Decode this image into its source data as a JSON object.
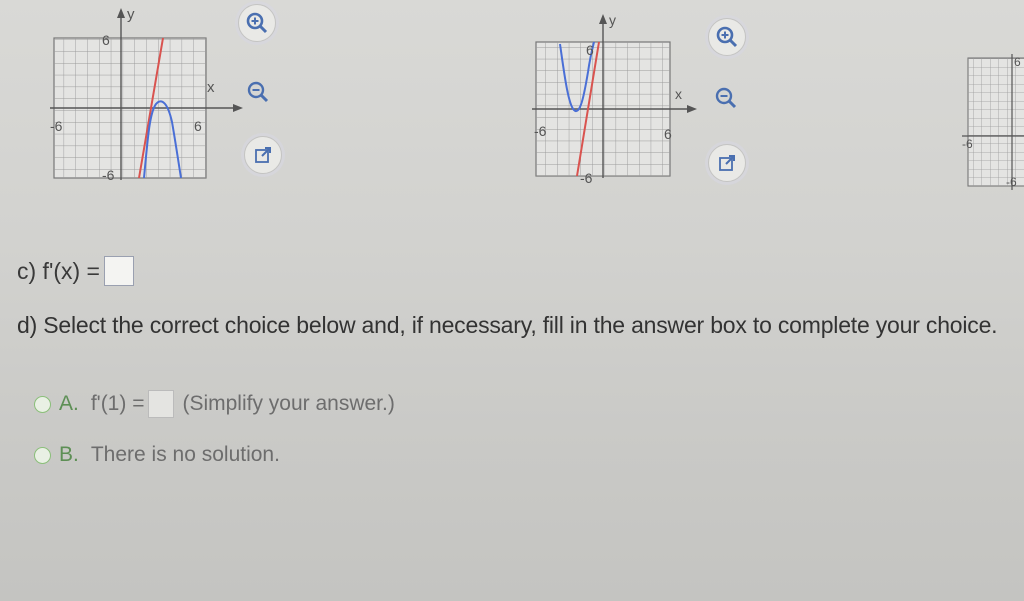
{
  "graphs": {
    "graph_a": {
      "y_axis_label": "y",
      "x_axis_label": "x",
      "y_tick_top": "6",
      "y_tick_bottom": "-6",
      "x_tick_left": "-6",
      "x_tick_right": "6"
    },
    "graph_b": {
      "y_axis_label": "y",
      "x_axis_label": "x",
      "y_tick_top": "6",
      "y_tick_bottom": "-6",
      "x_tick_left": "-6",
      "x_tick_right": "6"
    },
    "graph_c": {
      "y_tick_top": "6",
      "y_tick_bottom": "-6",
      "x_tick_left": "-6"
    },
    "colors": {
      "red_curve": "#d9534f",
      "blue_curve": "#4a6fd6",
      "grid": "#8a8a8a"
    }
  },
  "icons": {
    "zoom_in": "zoom-in-icon",
    "zoom_out": "zoom-out-icon",
    "open_new_window": "open-new-window-icon"
  },
  "question_c": {
    "prompt": "c) f'(x) ="
  },
  "question_d": {
    "instruction": "d) Select the correct choice below and, if necessary, fill in the answer box to complete your choice.",
    "choice_a": {
      "letter": "A.",
      "text_before": "f'(1) =",
      "text_after": "(Simplify your answer.)"
    },
    "choice_b": {
      "letter": "B.",
      "text": "There is no solution."
    }
  }
}
